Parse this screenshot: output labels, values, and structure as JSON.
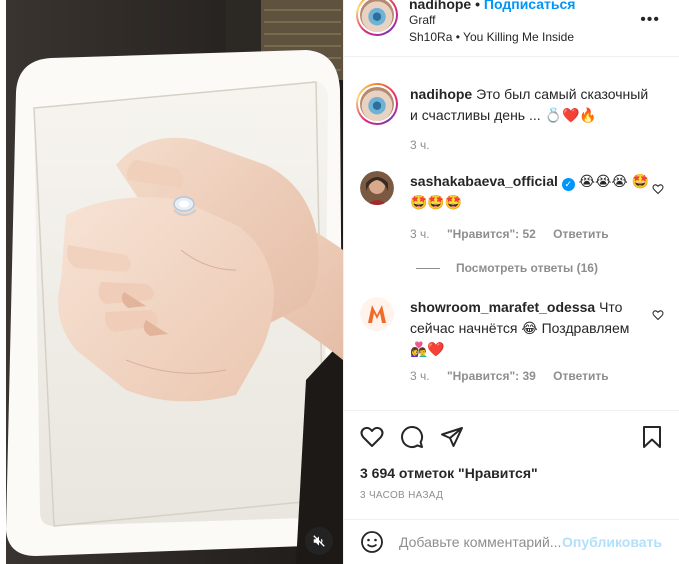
{
  "post": {
    "username": "nadihope",
    "follow_label": "Подписаться",
    "dot": "•",
    "location": "Graff",
    "music_artist": "Sh10Ra",
    "music_sep": "•",
    "music_track": "You Killing Me Inside",
    "more_label": "•••",
    "media_mute_icon": "speaker-muted-icon"
  },
  "caption": {
    "username": "nadihope",
    "text": "Это был самый сказочный и счастливы день ... 💍❤️🔥",
    "time": "3 ч."
  },
  "comments": [
    {
      "username": "sashakabaeva_official",
      "verified": true,
      "verified_glyph": "✓",
      "text": "😭😭😭 🤩🤩🤩🤩",
      "time": "3 ч.",
      "likes": "\"Нравится\": 52",
      "reply": "Ответить",
      "view_replies": "Посмотреть ответы (16)"
    },
    {
      "username": "showroom_marafet_odessa",
      "verified": false,
      "text": "Что сейчас начнётся 😂 Поздравляем 👩‍❤️‍👨❤️",
      "time": "3 ч.",
      "likes": "\"Нравится\": 39",
      "reply": "Ответить"
    }
  ],
  "actions": {
    "like_icon": "heart-icon",
    "comment_icon": "comment-icon",
    "share_icon": "send-icon",
    "save_icon": "bookmark-icon"
  },
  "likes_label": "3 694 отметок \"Нравится\"",
  "posted_ago": "3 ЧАСОВ НАЗАД",
  "composer": {
    "placeholder": "Добавьте комментарий...",
    "publish_label": "Опубликовать",
    "emoji_icon": "smiley-icon"
  },
  "colors": {
    "accent": "#0095f6",
    "publish_disabled": "#b2dffc",
    "muted_text": "#8e8e8e",
    "heart": "#ed4956"
  }
}
